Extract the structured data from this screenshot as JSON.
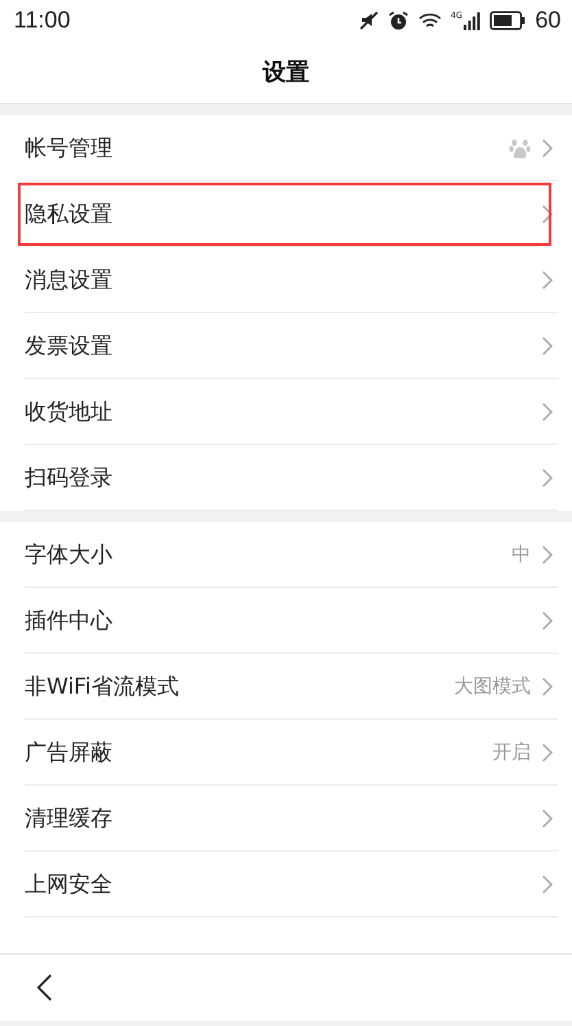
{
  "status_bar": {
    "time": "11:00",
    "battery_text": "60",
    "signal_label": "4G"
  },
  "title": "设置",
  "groups": [
    {
      "items": [
        {
          "kind": "paw",
          "label": "帐号管理",
          "highlighted": false
        },
        {
          "kind": "plain",
          "label": "隐私设置",
          "highlighted": true
        },
        {
          "kind": "plain",
          "label": "消息设置",
          "highlighted": false
        },
        {
          "kind": "plain",
          "label": "发票设置",
          "highlighted": false
        },
        {
          "kind": "plain",
          "label": "收货地址",
          "highlighted": false
        },
        {
          "kind": "plain",
          "label": "扫码登录",
          "highlighted": false
        }
      ]
    },
    {
      "items": [
        {
          "kind": "value",
          "label": "字体大小",
          "value": "中",
          "highlighted": false
        },
        {
          "kind": "plain",
          "label": "插件中心",
          "highlighted": false
        },
        {
          "kind": "value",
          "label": "非WiFi省流模式",
          "value": "大图模式",
          "highlighted": false
        },
        {
          "kind": "value",
          "label": "广告屏蔽",
          "value": "开启",
          "highlighted": false
        },
        {
          "kind": "plain",
          "label": "清理缓存",
          "highlighted": false
        },
        {
          "kind": "plain",
          "label": "上网安全",
          "highlighted": false
        }
      ]
    }
  ]
}
